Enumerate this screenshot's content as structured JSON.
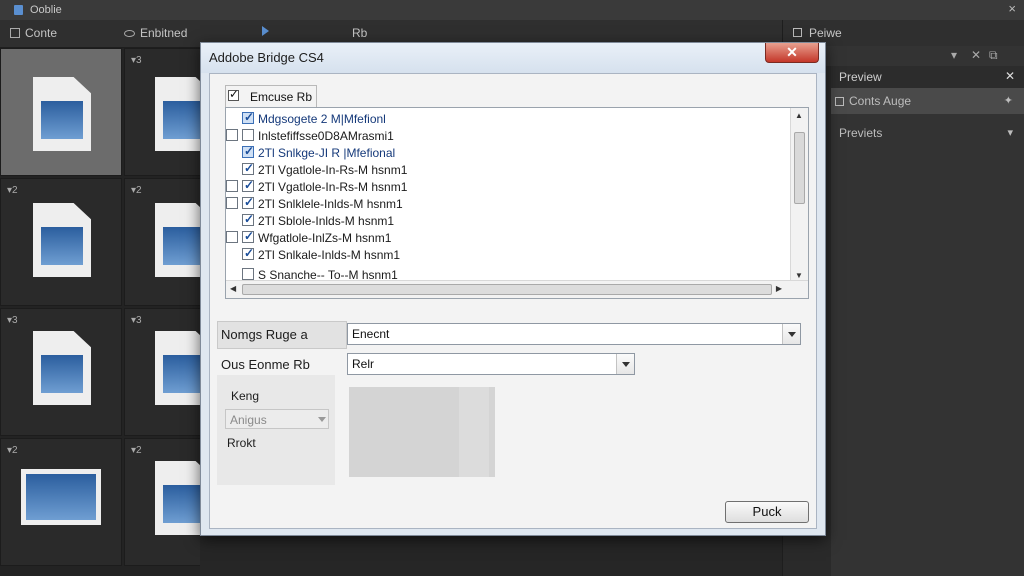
{
  "app": {
    "title": "Ooblie",
    "close_glyph": "×"
  },
  "toolbar": {
    "item1": "Conte",
    "item2": "Enbitned",
    "item3": "Rb",
    "preview_label": "Peiwe"
  },
  "thumbnails": [
    {
      "index": "",
      "kind": "doc",
      "selected": true
    },
    {
      "index": "▾3",
      "kind": "doc",
      "selected": false
    },
    {
      "index": "▾2",
      "kind": "doc",
      "selected": false
    },
    {
      "index": "▾2",
      "kind": "doc",
      "selected": false
    },
    {
      "index": "▾3",
      "kind": "doc",
      "selected": false
    },
    {
      "index": "▾3",
      "kind": "doc",
      "selected": false
    },
    {
      "index": "▾2",
      "kind": "landscape",
      "selected": false
    },
    {
      "index": "▾2",
      "kind": "doc",
      "selected": false
    }
  ],
  "right_panel": {
    "tools": [
      "▾",
      "✕",
      "⧉"
    ],
    "preview_header": "Preview",
    "preview_close": "✕",
    "row1": "Conts Auge",
    "row1_arrow": "✦",
    "row2": "Previets",
    "row2_arrow": "▾"
  },
  "dialog": {
    "title": "Addobe Bridge CS4",
    "close_glyph": "✕",
    "tab_label": "Emcuse Rb",
    "list_items": [
      {
        "label": "Mdgsogete 2 M|Mfefionl",
        "checked": true,
        "style": "blue"
      },
      {
        "label": "Inlstefiffsse0D8AMrasmi1",
        "checked": false,
        "style": "plain"
      },
      {
        "label": "2Tl Snlkge-JI R |Mfefional",
        "checked": true,
        "style": "blue"
      },
      {
        "label": "2Tl Vgatlole-In-Rs-M hsnm1",
        "checked": true,
        "style": "plain"
      },
      {
        "label": "2Tl Vgatlole-In-Rs-M hsnm1",
        "checked": true,
        "style": "plain"
      },
      {
        "label": "2Tl Snlklele-Inlds-M hsnm1",
        "checked": true,
        "style": "plain"
      },
      {
        "label": "2Tl Sblole-Inlds-M hsnm1",
        "checked": true,
        "style": "plain"
      },
      {
        "label": "Wfgatlole-InlZs-M hsnm1",
        "checked": true,
        "style": "plain"
      },
      {
        "label": "2Tl Snlkale-Inlds-M hsnm1",
        "checked": true,
        "style": "plain"
      },
      {
        "label": "S Snanche-- To--M hsnm1",
        "checked": false,
        "style": "plain"
      }
    ],
    "field1_label": "Nomgs Ruge a",
    "field1_value": "Enecnt",
    "field2_label": "Ous Eonme Rb",
    "field2_value": "Relr",
    "section_label": "Keng",
    "disabled_value": "Anigus",
    "section_label2": "Rrokt",
    "button_label": "Puck"
  }
}
